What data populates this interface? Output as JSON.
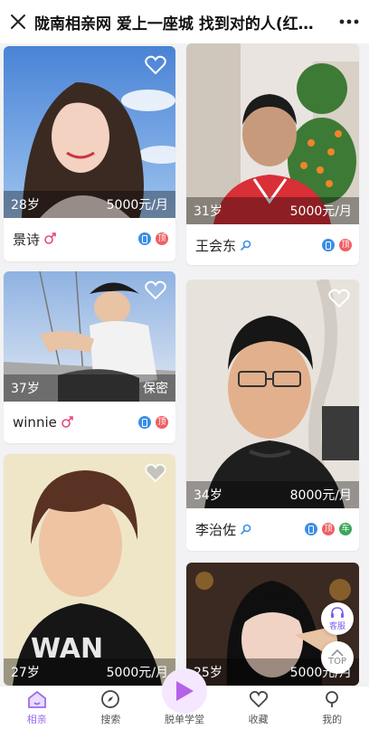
{
  "header": {
    "title": "陇南相亲网 爱上一座城 找到对的人(红娘...",
    "close_icon": "close-icon",
    "more_icon": "more-icon"
  },
  "cards": [
    {
      "age": "28岁",
      "salary": "5000元/月",
      "name": "景诗",
      "gender": "female",
      "badges": [
        "phone",
        "顶"
      ]
    },
    {
      "age": "31岁",
      "salary": "5000元/月",
      "name": "王会东",
      "gender": "male",
      "badges": [
        "phone",
        "顶"
      ]
    },
    {
      "age": "37岁",
      "salary": "保密",
      "name": "winnie",
      "gender": "female",
      "badges": [
        "phone",
        "顶"
      ]
    },
    {
      "age": "34岁",
      "salary": "8000元/月",
      "name": "李治佐",
      "gender": "male",
      "badges": [
        "phone",
        "顶",
        "车"
      ]
    },
    {
      "age": "27岁",
      "salary": "5000元/月"
    },
    {
      "age": "25岁",
      "salary": "5000元/月"
    }
  ],
  "float": {
    "service": "客服",
    "top": "TOP"
  },
  "nav": {
    "items": [
      "相亲",
      "搜索",
      "脱单学堂",
      "收藏",
      "我的"
    ],
    "active": 0
  },
  "colors": {
    "accent": "#9b6cf0",
    "female": "#e8487a",
    "male": "#3a8ee6"
  }
}
